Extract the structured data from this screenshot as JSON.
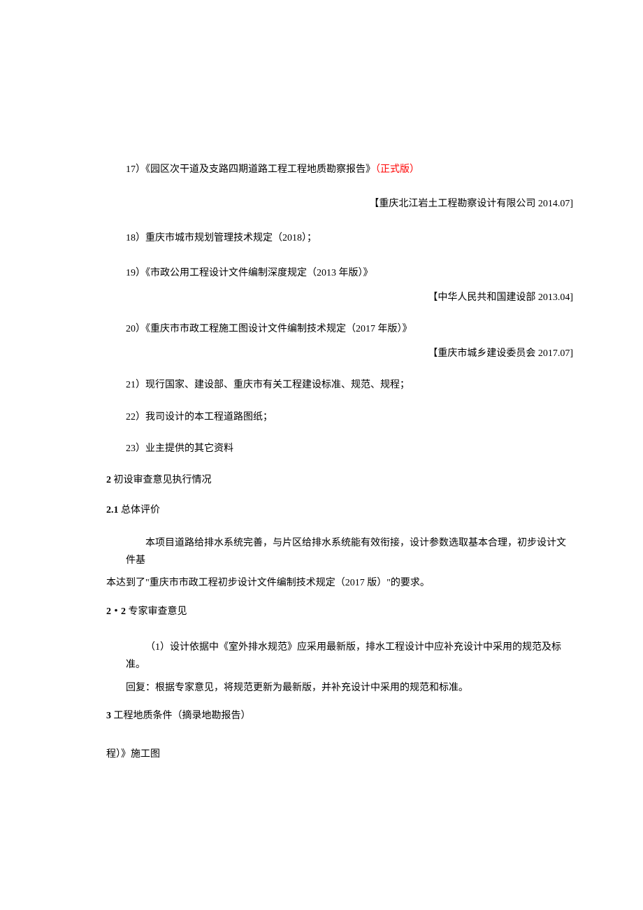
{
  "items": {
    "17_prefix": "17）《园区次干道及支路四期道路工程工程地质勘察报告》",
    "17_red": "（正式版）",
    "17_source": "【重庆北江岩土工程勘察设计有限公司 2014.07]",
    "18": "18）重庆市城市规划管理技术规定（2018）；",
    "19": "19）《市政公用工程设计文件编制深度规定（2013 年版）》",
    "19_source": "【中华人民共和国建设部 2013.04]",
    "20": "20）《重庆市市政工程施工图设计文件编制技术规定（2017 年版）》",
    "20_source": "【重庆市城乡建设委员会 2017.07]",
    "21": "21）现行国家、建设部、重庆市有关工程建设标准、规范、规程；",
    "22": "22）我司设计的本工程道路图纸；",
    "23": "23）业主提供的其它资料"
  },
  "section2": {
    "h2_num": "2 ",
    "h2_text": "初设审查意见执行情况",
    "h21": "2.1 ",
    "h21_text": "总体评价",
    "body1_line1": "本项目道路给排水系统完善，与片区给排水系统能有效衔接，设计参数选取基本合理，初步设计文件基",
    "body1_line2": "本达到了\"重庆市市政工程初步设计文件编制技术规定（2017 版）\"的要求。",
    "h22_num": "2・2 ",
    "h22_text": "专家审查意见",
    "body2_item1": "（1）设计依据中《室外排水规范》应采用最新版，排水工程设计中应补充设计中采用的规范及标准。",
    "body2_reply": "回复：根据专家意见，将规范更新为最新版，并补充设计中采用的规范和标准。"
  },
  "section3": {
    "h3_num": "3 ",
    "h3_text": "工程地质条件（摘录地勘报告）"
  },
  "tail": "程）》施工图"
}
